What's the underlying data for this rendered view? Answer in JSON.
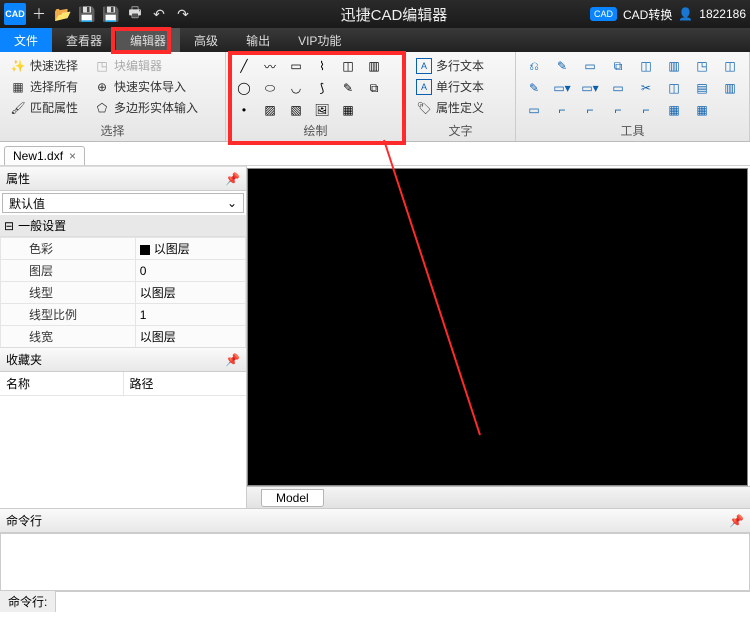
{
  "titlebar": {
    "title": "迅捷CAD编辑器",
    "cad_label": "CAD",
    "convert_label": "CAD转换",
    "user_id": "1822186"
  },
  "menu": {
    "file": "文件",
    "view": "查看器",
    "editor": "编辑器",
    "advanced": "高级",
    "output": "输出",
    "vip": "VIP功能"
  },
  "ribbon": {
    "group1": {
      "quick_select": "快速选择",
      "select_all": "选择所有",
      "match_props": "匹配属性",
      "block_editor": "块编辑器",
      "quick_entity_import": "快速实体导入",
      "polygon_entity_input": "多边形实体输入",
      "label": "选择"
    },
    "group2": {
      "label": "绘制"
    },
    "group3": {
      "mtext": "多行文本",
      "stext": "单行文本",
      "attdef": "属性定义",
      "label": "文字"
    },
    "group4": {
      "label": "工具"
    }
  },
  "filetab": {
    "name": "New1.dxf"
  },
  "panels": {
    "props_title": "属性",
    "default_value": "默认值",
    "general_section": "一般设置",
    "rows": [
      {
        "k": "色彩",
        "v": "以图层",
        "swatch": true
      },
      {
        "k": "图层",
        "v": "0"
      },
      {
        "k": "线型",
        "v": "以图层"
      },
      {
        "k": "线型比例",
        "v": "1"
      },
      {
        "k": "线宽",
        "v": "以图层"
      }
    ],
    "fav_title": "收藏夹",
    "fav_name": "名称",
    "fav_path": "路径"
  },
  "canvas": {
    "model_tab": "Model"
  },
  "cmd": {
    "title": "命令行",
    "prompt": "命令行:"
  }
}
